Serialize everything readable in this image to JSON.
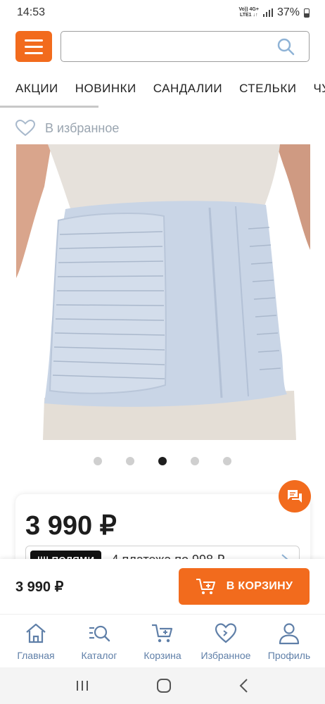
{
  "status_bar": {
    "time": "14:53",
    "network_top": "Vo)) 4G+",
    "network_bottom": "LTE1 ↓↑",
    "battery": "37%"
  },
  "header": {
    "search_placeholder": ""
  },
  "categories": [
    "АКЦИИ",
    "НОВИНКИ",
    "САНДАЛИИ",
    "СТЕЛЬКИ",
    "ЧУ"
  ],
  "favorite_label": "В избранное",
  "carousel": {
    "count": 5,
    "active_index": 2
  },
  "price_card": {
    "price": "3 990 ₽",
    "installment_badge": "|||| ПОЛЯМИ",
    "installment_text": "4 платежа по 998 ₽"
  },
  "buy_bar": {
    "price": "3 990 ₽",
    "cart_button": "В КОРЗИНУ"
  },
  "bottom_nav": [
    {
      "label": "Главная",
      "icon": "home-icon"
    },
    {
      "label": "Каталог",
      "icon": "catalog-search-icon"
    },
    {
      "label": "Корзина",
      "icon": "cart-icon"
    },
    {
      "label": "Избранное",
      "icon": "heart-icon"
    },
    {
      "label": "Профиль",
      "icon": "profile-icon"
    }
  ],
  "colors": {
    "accent": "#f26b1d",
    "nav_icon": "#5f7fa8",
    "fav_text": "#9aa5b0"
  }
}
